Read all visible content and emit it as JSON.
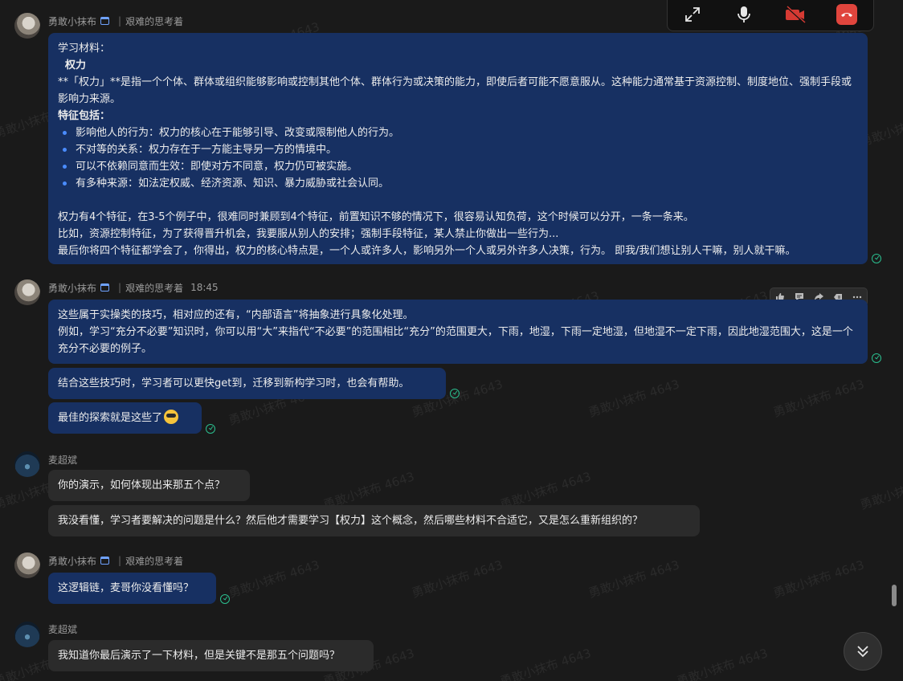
{
  "watermark": "勇敢小抹布 4643",
  "callbar": {
    "expand_icon": "expand-icon",
    "mic_icon": "microphone-icon",
    "camera_icon": "camera-off-icon",
    "hangup_icon": "hang-up-icon",
    "hangup_color": "#e0453d"
  },
  "colors": {
    "own_bubble": "#173062",
    "other_bubble": "#2b2b2b",
    "bullet": "#4a8cff",
    "read": "#2bbf8f"
  },
  "messages": {
    "m1": {
      "sender": "勇敢小抹布",
      "group": "艰难的思考着",
      "lines": {
        "l1": "学习材料：",
        "l2": "  权力",
        "l3": "**「权力」**是指一个个体、群体或组织能够影响或控制其他个体、群体行为或决策的能力，即使后者可能不愿意服从。这种能力通常基于资源控制、制度地位、强制手段或影响力来源。",
        "l4": "特征包括：",
        "b1": "影响他人的行为：权力的核心在于能够引导、改变或限制他人的行为。",
        "b2": "不对等的关系：权力存在于一方能主导另一方的情境中。",
        "b3": "可以不依赖同意而生效：即使对方不同意，权力仍可被实施。",
        "b4": "有多种来源：如法定权威、经济资源、知识、暴力威胁或社会认同。",
        "l5": "权力有4个特征，在3-5个例子中，很难同时兼顾到4个特征，前置知识不够的情况下，很容易认知负荷，这个时候可以分开，一条一条来。",
        "l6": "比如，资源控制特征，为了获得晋升机会，我要服从别人的安排；强制手段特征，某人禁止你做出一些行为...",
        "l7": "最后你将四个特征都学会了，你得出，权力的核心特点是，一个人或许多人，影响另外一个人或另外许多人决策，行为。 即我/我们想让别人干嘛，别人就干嘛。"
      }
    },
    "m2": {
      "sender": "勇敢小抹布",
      "group": "艰难的思考着",
      "time": "18:45",
      "toolbar": [
        "thumbs-up-icon",
        "comment-icon",
        "share-icon",
        "reply-icon",
        "more-icon"
      ],
      "b1_l1": "这些属于实操类的技巧，相对应的还有，“内部语言”将抽象进行具象化处理。",
      "b1_l2": "例如，学习“充分不必要”知识时，你可以用“大”来指代“不必要”的范围相比“充分”的范围更大，下雨，地湿，下雨一定地湿，但地湿不一定下雨，因此地湿范围大，这是一个充分不必要的例子。",
      "b2": "结合这些技巧时，学习者可以更快get到，迁移到新构学习时，也会有帮助。",
      "b3": "最佳的探索就是这些了",
      "b3_emoji": "sunglasses-emoji"
    },
    "m3": {
      "sender": "麦超斌",
      "b1": "你的演示，如何体现出来那五个点？",
      "b2": "我没看懂，学习者要解决的问题是什么？然后他才需要学习【权力】这个概念，然后哪些材料不合适它，又是怎么重新组织的？"
    },
    "m4": {
      "sender": "勇敢小抹布",
      "group": "艰难的思考着",
      "b1": "这逻辑链，麦哥你没看懂吗？"
    },
    "m5": {
      "sender": "麦超斌",
      "b1": "我知道你最后演示了一下材料，但是关键不是那五个问题吗？"
    }
  },
  "scroll_down_icon": "double-chevron-down-icon"
}
